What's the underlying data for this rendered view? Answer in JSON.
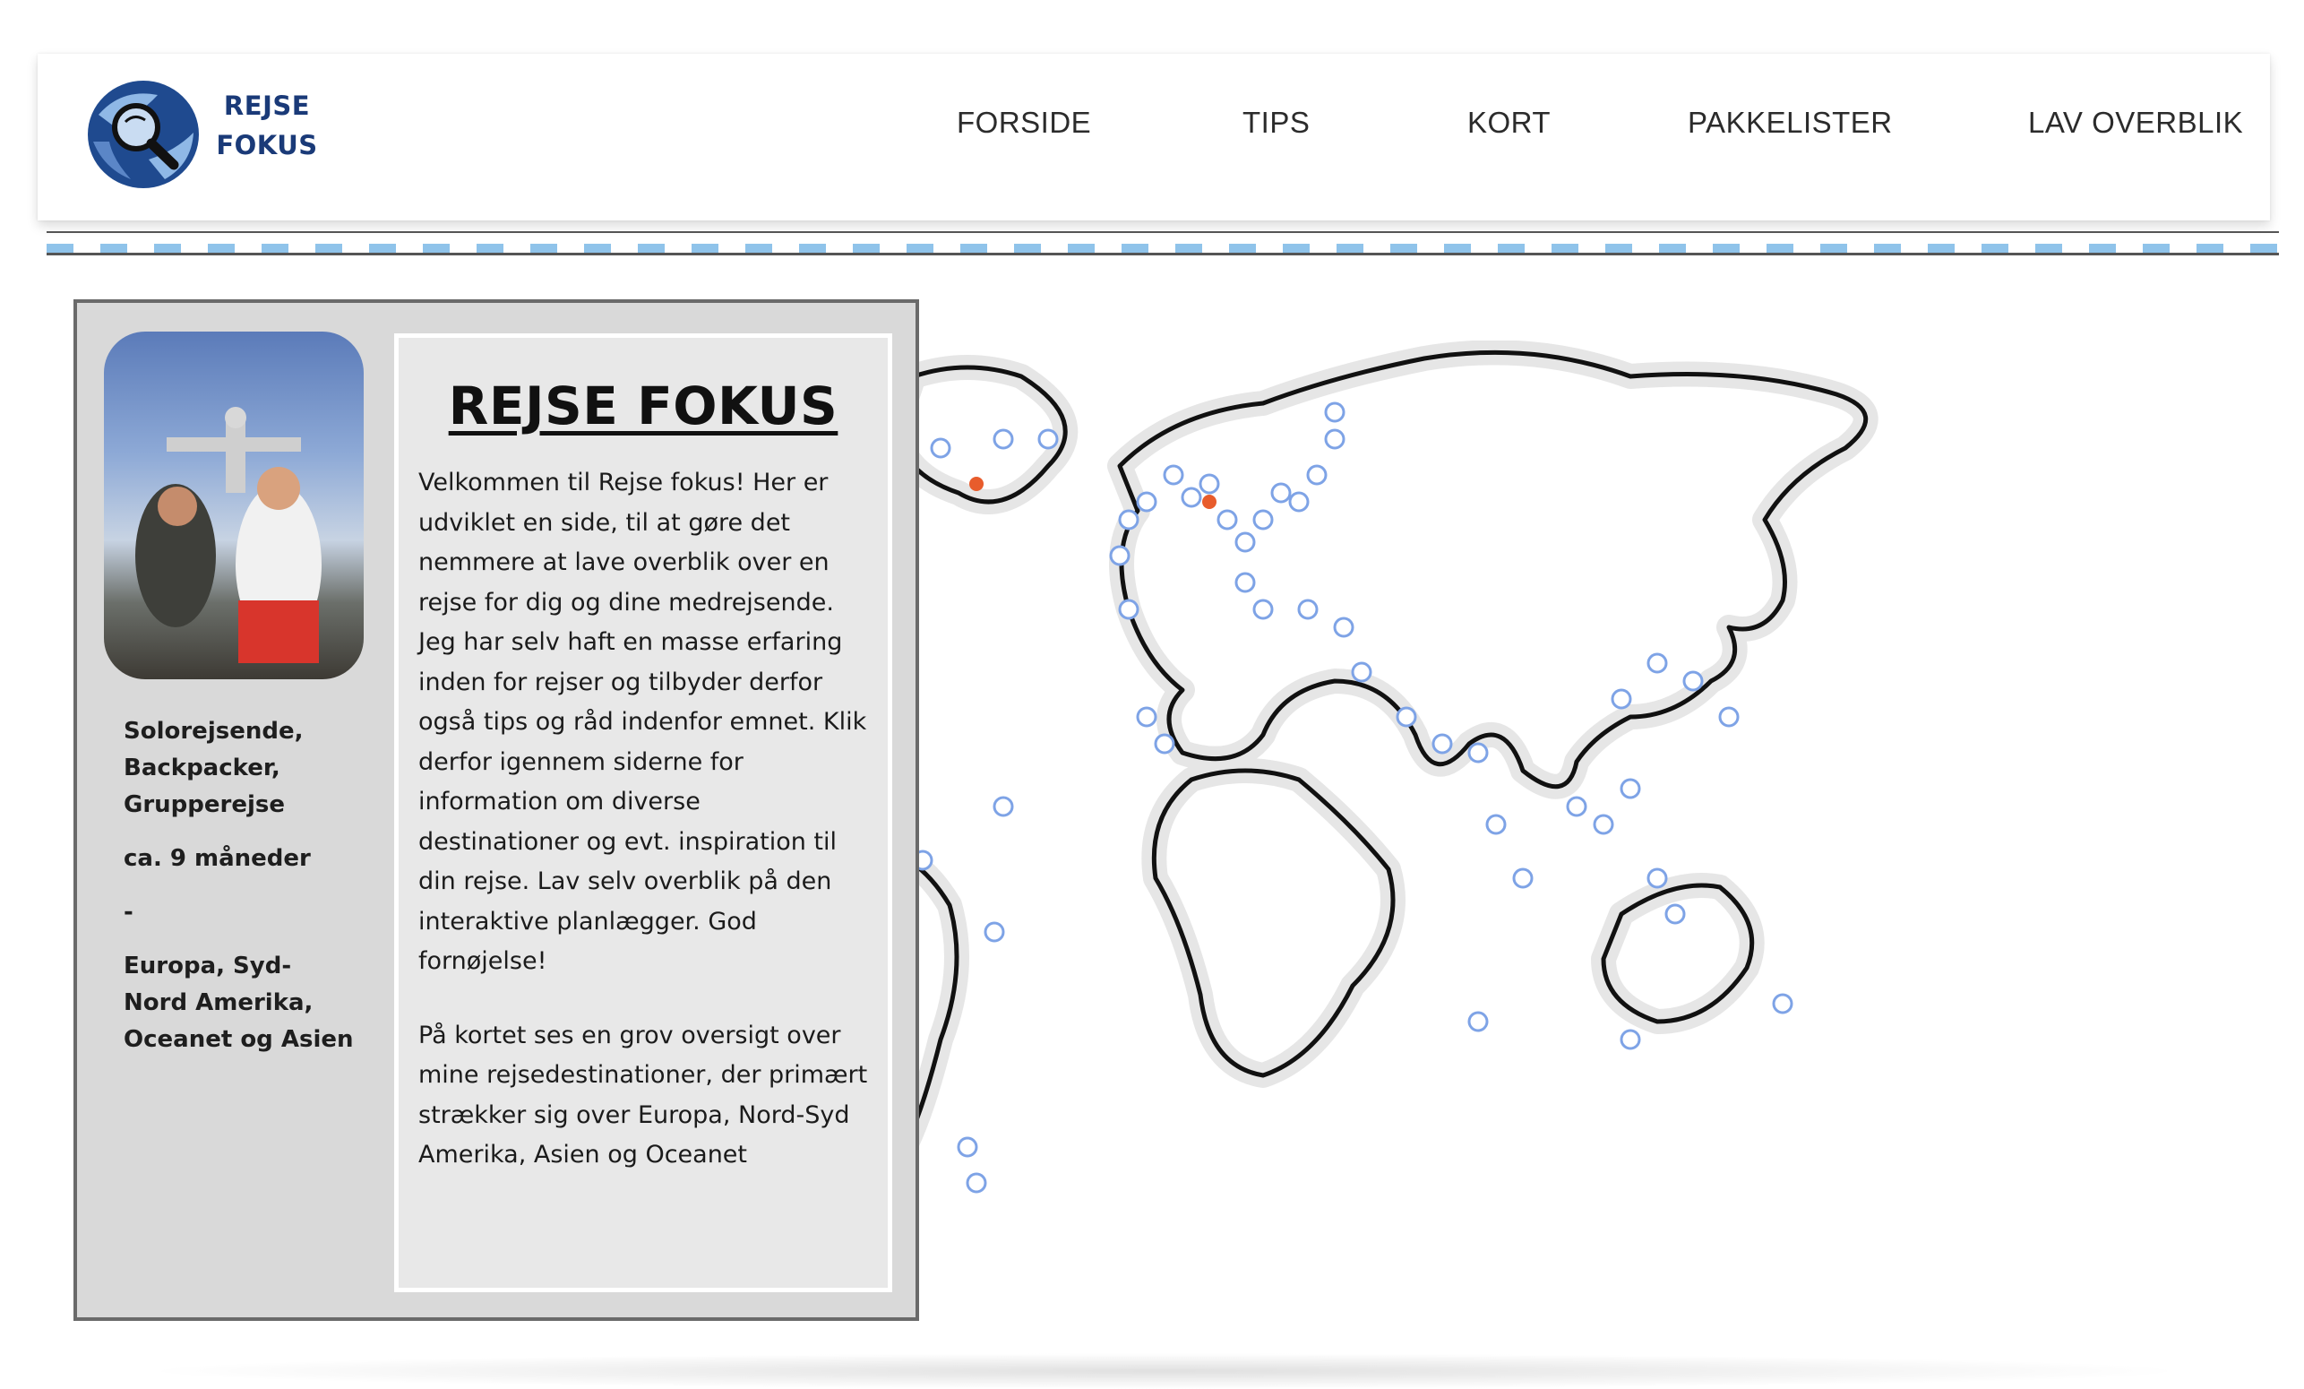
{
  "header": {
    "logo_line1": "REJSE",
    "logo_line2": "FOKUS",
    "logo_icon": "magnifier-globe-icon",
    "nav": [
      {
        "label": "FORSIDE"
      },
      {
        "label": "TIPS"
      },
      {
        "label": "KORT"
      },
      {
        "label": "PAKKELISTER"
      },
      {
        "label": "LAV OVERBLIK"
      }
    ]
  },
  "profile": {
    "photo": "travel-photo",
    "travel_type": "Solorejsende, Backpacker, Grupperejse",
    "duration": "ca. 9 måneder",
    "separator": "-",
    "regions": "Europa, Syd- Nord Amerika, Oceanet og Asien"
  },
  "intro": {
    "title": "REJSE FOKUS",
    "paragraph1": "Velkommen til Rejse fokus! Her er udviklet en side, til at gøre det nemmere at lave overblik over en rejse for dig og dine medrejsende. Jeg har selv haft en masse erfaring inden for rejser og tilbyder derfor også tips og råd indenfor emnet. Klik derfor igennem siderne for information om diverse destinationer og evt. inspiration til din rejse. Lav selv overblik på den interaktive planlægger. God fornøjelse!",
    "paragraph2": "På kortet ses en grov oversigt over mine rejsedestinationer, der primært strækker sig over Europa, Nord-Syd Amerika, Asien og Oceanet"
  },
  "colors": {
    "brand_blue": "#1a3a78",
    "accent_light_blue": "#8fc3ea",
    "marker_blue": "#7ea3e6",
    "marker_orange": "#e85c2c",
    "card_gray": "#d9d9d9"
  }
}
